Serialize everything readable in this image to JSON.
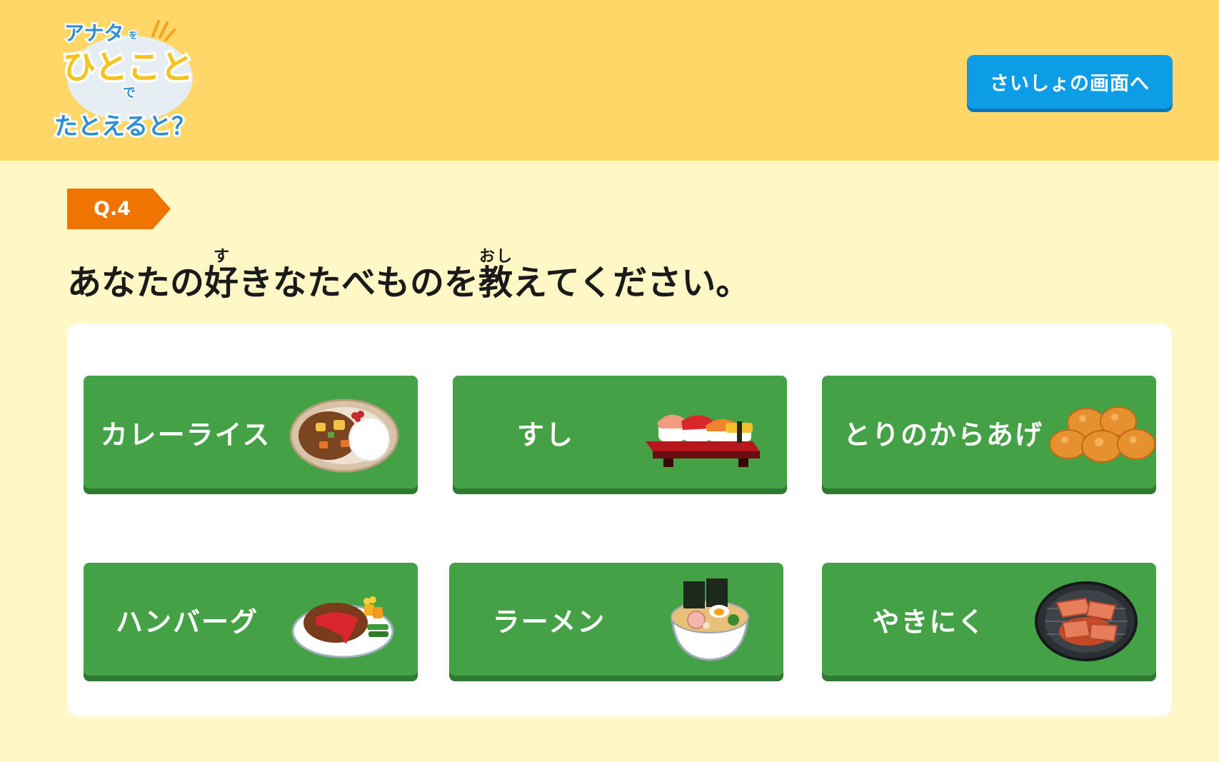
{
  "header": {
    "logo": {
      "line1": "アナタ",
      "line1_small": "を",
      "line2": "ひとこと",
      "line3": "で",
      "line4": "たとえると？"
    },
    "home_button": "さいしょの画面へ"
  },
  "question": {
    "number": "Q.4",
    "parts": [
      {
        "text": "あなたの"
      },
      {
        "text": "好",
        "ruby": "す"
      },
      {
        "text": "きなたべものを"
      },
      {
        "text": "教",
        "ruby": "おし"
      },
      {
        "text": "えてください。"
      }
    ]
  },
  "choices": [
    {
      "label": "カレーライス",
      "icon": "curry-rice-icon"
    },
    {
      "label": "すし",
      "icon": "sushi-icon"
    },
    {
      "label": "とりのからあげ",
      "icon": "karaage-icon"
    },
    {
      "label": "ハンバーグ",
      "icon": "hamburg-steak-icon"
    },
    {
      "label": "ラーメン",
      "icon": "ramen-icon"
    },
    {
      "label": "やきにく",
      "icon": "yakiniku-icon"
    }
  ],
  "colors": {
    "header_bg": "#ffd768",
    "page_bg": "#fff8c6",
    "button_blue": "#0d9de6",
    "badge_orange": "#ef7400",
    "choice_green": "#45a146"
  }
}
